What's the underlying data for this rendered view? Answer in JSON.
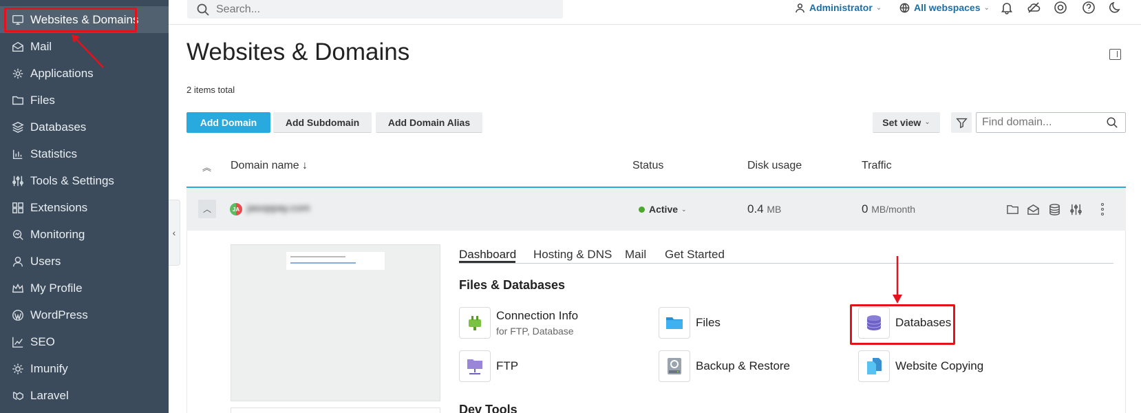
{
  "sidebar": {
    "items": [
      {
        "label": "Websites & Domains",
        "icon": "monitor-icon"
      },
      {
        "label": "Mail",
        "icon": "envelope-icon"
      },
      {
        "label": "Applications",
        "icon": "gear-icon"
      },
      {
        "label": "Files",
        "icon": "folder-icon"
      },
      {
        "label": "Databases",
        "icon": "layers-icon"
      },
      {
        "label": "Statistics",
        "icon": "bar-chart-icon"
      },
      {
        "label": "Tools & Settings",
        "icon": "sliders-icon"
      },
      {
        "label": "Extensions",
        "icon": "grid-icon"
      },
      {
        "label": "Monitoring",
        "icon": "magnifier-icon"
      },
      {
        "label": "Users",
        "icon": "user-icon"
      },
      {
        "label": "My Profile",
        "icon": "crown-icon"
      },
      {
        "label": "WordPress",
        "icon": "wordpress-icon"
      },
      {
        "label": "SEO",
        "icon": "chart-up-icon"
      },
      {
        "label": "Imunify",
        "icon": "cog-icon"
      },
      {
        "label": "Laravel",
        "icon": "laravel-icon"
      }
    ],
    "active": "Websites & Domains"
  },
  "topbar": {
    "search_placeholder": "Search...",
    "user": "Administrator",
    "webspace": "All webspaces"
  },
  "page": {
    "title": "Websites & Domains",
    "items_total": "2 items total"
  },
  "toolbar": {
    "add_domain": "Add Domain",
    "add_subdomain": "Add Subdomain",
    "add_domain_alias": "Add Domain Alias",
    "set_view": "Set view",
    "find_placeholder": "Find domain..."
  },
  "table": {
    "headers": {
      "domain_name": "Domain name ↓",
      "status": "Status",
      "disk_usage": "Disk usage",
      "traffic": "Traffic"
    },
    "row": {
      "avatar": "JA",
      "domain": "jasoppay.com",
      "status": "Active",
      "disk_value": "0.4",
      "disk_unit": "MB",
      "traffic_value": "0",
      "traffic_unit": "MB/month"
    }
  },
  "details": {
    "tabs": [
      "Dashboard",
      "Hosting & DNS",
      "Mail",
      "Get Started"
    ],
    "active_tab": "Dashboard",
    "section1": "Files & Databases",
    "section2": "Dev Tools",
    "tools": [
      {
        "label": "Connection Info",
        "sub": "for FTP, Database",
        "icon": "plug-icon"
      },
      {
        "label": "Files",
        "sub": "",
        "icon": "folder-icon"
      },
      {
        "label": "Databases",
        "sub": "",
        "icon": "database-icon"
      },
      {
        "label": "FTP",
        "sub": "",
        "icon": "ftp-folder-icon"
      },
      {
        "label": "Backup & Restore",
        "sub": "",
        "icon": "backup-icon"
      },
      {
        "label": "Website Copying",
        "sub": "",
        "icon": "copy-icon"
      }
    ]
  },
  "colors": {
    "sidebar_bg": "#3b4b5b",
    "primary": "#28aade",
    "highlight": "#e3121b",
    "status_active": "#4fa62d"
  }
}
